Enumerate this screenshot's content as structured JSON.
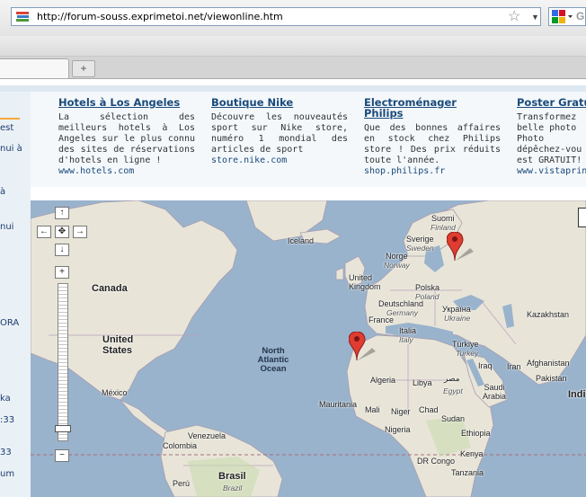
{
  "browser": {
    "url": "http://forum-souss.exprimetoi.net/viewonline.htm",
    "site_icon": "books-favicon-icon",
    "bookmark_star": "star-icon",
    "search_engine_icon": "google-icon"
  },
  "tabs": {
    "new_tab_label": "+"
  },
  "sidebar": {
    "items": [
      "est",
      "nui à",
      "à",
      "nui",
      "ORA",
      "ka",
      ":33",
      "33",
      "um"
    ]
  },
  "ads": [
    {
      "title": "Hotels à Los Angeles",
      "body": "La sélection des meilleurs hotels à Los Angeles sur le plus connu des sites de réservations d'hotels en ligne !",
      "url": "www.hotels.com"
    },
    {
      "title": "Boutique Nike",
      "body": "Découvre les nouveautés sport sur Nike store, numéro 1 mondial des articles de sport",
      "url": "store.nike.com"
    },
    {
      "title": "Electroménager Philips",
      "body": "Que des bonnes affaires en stock chez Philips store ! Des prix réduits toute l'année.",
      "url": "shop.philips.fr"
    },
    {
      "title": "Poster Gratu",
      "body": "Transformez belle photo Photo dépêchez-vou est GRATUIT!",
      "url": "www.vistaprint"
    }
  ],
  "map": {
    "controls": {
      "pan_up": "↑",
      "pan_left": "←",
      "pan_center": "✥",
      "pan_right": "→",
      "pan_down": "↓",
      "zoom_in": "+",
      "zoom_out": "−"
    },
    "markers": [
      "map-marker-finland",
      "map-marker-morocco"
    ],
    "labels": {
      "canada": "Canada",
      "united_states": "United States",
      "mexico": "México",
      "iceland": "Iceland",
      "north_atlantic_ocean": "North Atlantic Ocean",
      "suomi": "Suomi",
      "finland": "Finland",
      "sverige": "Sverige",
      "sweden": "Sweden",
      "norge": "Norge",
      "norway": "Norway",
      "united_kingdom": "United Kingdom",
      "polska": "Polska",
      "poland": "Poland",
      "deutschland": "Deutschland",
      "germany": "Germany",
      "ukraine_native": "Україна",
      "ukraine": "Ukraine",
      "france": "France",
      "italia": "Italia",
      "italy": "Italy",
      "kazakhstan": "Kazakhstan",
      "turkiye": "Türkiye",
      "turkey": "Turkey",
      "iraq": "Iraq",
      "iran": "Iran",
      "afghanistan": "Afghanistan",
      "pakistan": "Pakistan",
      "india": "Indi",
      "algeria": "Algeria",
      "libya": "Libya",
      "egypt_native": "مصر",
      "egypt": "Egypt",
      "saudi_arabia": "Saudi Arabia",
      "mauritania": "Mauritania",
      "mali": "Mali",
      "niger": "Niger",
      "chad": "Chad",
      "sudan": "Sudan",
      "nigeria": "Nigeria",
      "ethiopia": "Ethiopia",
      "kenya": "Kenya",
      "dr_congo": "DR Congo",
      "tanzania": "Tanzania",
      "venezuela": "Venezuela",
      "colombia": "Colombia",
      "brasil": "Brasil",
      "brazil": "Brazil",
      "peru": "Perú"
    }
  }
}
